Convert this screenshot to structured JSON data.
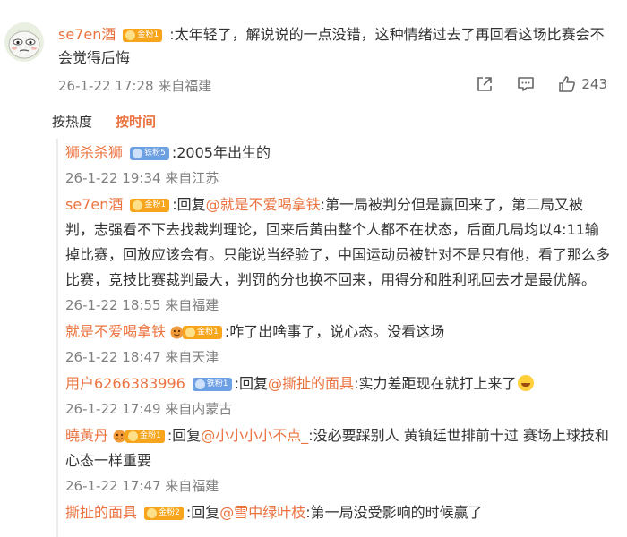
{
  "main_comment": {
    "username": "se7en酒",
    "badge": "金粉1",
    "text": ":太年轻了，解说说的一点没错，这种情绪过去了再回看这场比赛会不会觉得后悔",
    "timestamp": "26-1-22 17:28 来自福建",
    "like_count": "243"
  },
  "sort": {
    "hot_label": "按热度",
    "time_label": "按时间",
    "active": "time"
  },
  "replies": [
    {
      "username": "狮杀杀狮",
      "badge": "铁粉5",
      "badge_type": "iron",
      "prefix": "",
      "mention": "",
      "text": ":2005年出生的",
      "meta": "26-1-22 19:34 来自江苏"
    },
    {
      "username": "se7en酒",
      "badge": "金粉1",
      "badge_type": "gold",
      "prefix": ":回复",
      "mention": "@就是不爱喝拿铁",
      "text": ":第一局被判分但是赢回来了，第二局又被判，志强看不下去找裁判理论，回来后黄由整个人都不在状态，后面几局均以4:11输掉比赛，回放应该会有。只能说当经验了，中国运动员被针对不是只有他，看了那么多比赛，竞技比赛裁判最大，判罚的分也换不回来，用得分和胜利吼回去才是最优解。",
      "meta": "26-1-22 18:55 来自福建"
    },
    {
      "username": "就是不爱喝拿铁",
      "badge": "金粉1",
      "badge_type": "gold",
      "prefix": "",
      "mention": "",
      "text": ":咋了出啥事了，说心态。没看这场",
      "meta": "26-1-22 18:47 来自天津"
    },
    {
      "username": "用户6266383996",
      "badge": "铁粉1",
      "badge_type": "iron",
      "prefix": ":回复",
      "mention": "@撕扯的面具",
      "text": ":实力差距现在就打上来了",
      "emoji": "laugh-cry-emoji",
      "meta": "26-1-22 17:49 来自内蒙古"
    },
    {
      "username": "曉黃丹",
      "badge": "金粉1",
      "badge_type": "gold",
      "prefix": ":回复",
      "mention": "@小小小小不点_",
      "text": ":没必要踩别人 黄镇廷世排前十过 赛场上球技和心态一样重要",
      "meta": "26-1-22 17:47 来自福建"
    },
    {
      "username": "撕扯的面具",
      "badge": "金粉2",
      "badge_type": "gold",
      "prefix": ":回复",
      "mention": "@雪中绿叶枝",
      "text": ":第一局没受影响的时候赢了",
      "meta": ""
    }
  ],
  "icons": [
    "share-icon",
    "comment-icon",
    "like-icon"
  ],
  "colors": {
    "accent": "#eb7340",
    "meta": "#808080",
    "gold_badge": "#f7a51c",
    "iron_badge": "#6d9fe3"
  }
}
